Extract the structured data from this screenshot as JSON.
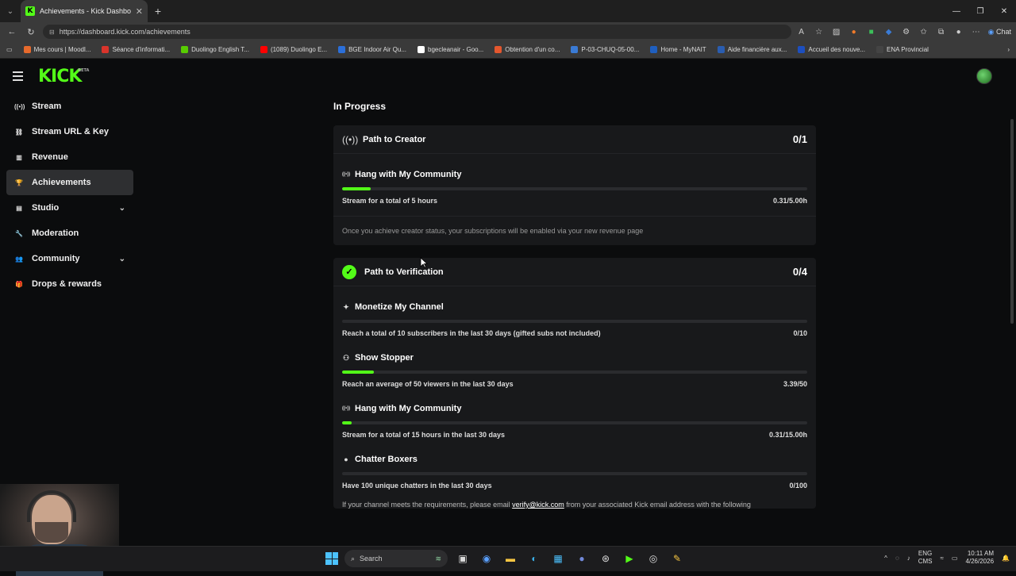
{
  "browser": {
    "tab_title": "Achievements - Kick Dashboard",
    "url": "https://dashboard.kick.com/achievements",
    "chat_label": "Chat",
    "bookmarks": [
      {
        "label": "Mes cours | Moodl...",
        "color": "#e66a2c"
      },
      {
        "label": "Séance d'informati...",
        "color": "#d9342b"
      },
      {
        "label": "Duolingo English T...",
        "color": "#58cc02"
      },
      {
        "label": "(1089) Duolingo E...",
        "color": "#ff0000"
      },
      {
        "label": "BGE Indoor Air Qu...",
        "color": "#2b6fd9"
      },
      {
        "label": "bgecleanair - Goo...",
        "color": "#ffffff"
      },
      {
        "label": "Obtention d'un co...",
        "color": "#e4572e"
      },
      {
        "label": "P-03-CHUQ-05-00...",
        "color": "#3a7bd5"
      },
      {
        "label": "Home - MyNAIT",
        "color": "#1f5fbf"
      },
      {
        "label": "Aide financière aux...",
        "color": "#2a5db0"
      },
      {
        "label": "Accueil des nouve...",
        "color": "#1d4fbf"
      },
      {
        "label": "ENA Provincial",
        "color": "#444444"
      }
    ]
  },
  "header": {
    "logo": "KICK",
    "logo_badge": "BETA"
  },
  "sidebar": {
    "items": [
      {
        "label": "Stream",
        "icon": "broadcast-icon"
      },
      {
        "label": "Stream URL & Key",
        "icon": "link-icon"
      },
      {
        "label": "Revenue",
        "icon": "chart-icon"
      },
      {
        "label": "Achievements",
        "icon": "trophy-icon",
        "active": true
      },
      {
        "label": "Studio",
        "icon": "studio-icon",
        "expandable": true
      },
      {
        "label": "Moderation",
        "icon": "wrench-icon"
      },
      {
        "label": "Community",
        "icon": "people-icon",
        "expandable": true
      },
      {
        "label": "Drops & rewards",
        "icon": "gift-icon"
      }
    ]
  },
  "main": {
    "section_title": "In Progress",
    "creator": {
      "title": "Path to Creator",
      "count": "0/1",
      "achievements": [
        {
          "title": "Hang with My Community",
          "desc": "Stream for a total of 5 hours",
          "value": "0.31/5.00h",
          "progress": 0.062
        }
      ],
      "note": "Once you achieve creator status, your subscriptions will be enabled via your new revenue page"
    },
    "verification": {
      "title": "Path to Verification",
      "count": "0/4",
      "achievements": [
        {
          "title": "Monetize My Channel",
          "desc": "Reach a total of 10 subscribers in the last 30 days (gifted subs not included)",
          "value": "0/10",
          "progress": 0.0
        },
        {
          "title": "Show Stopper",
          "desc": "Reach an average of 50 viewers in the last 30 days",
          "value": "3.39/50",
          "progress": 0.068
        },
        {
          "title": "Hang with My Community",
          "desc": "Stream for a total of 15 hours in the last 30 days",
          "value": "0.31/15.00h",
          "progress": 0.021
        },
        {
          "title": "Chatter Boxers",
          "desc": "Have 100 unique chatters in the last 30 days",
          "value": "0/100",
          "progress": 0.0
        }
      ],
      "footer_pre": "If your channel meets the requirements, please email ",
      "footer_link": "verify@kick.com",
      "footer_post": " from your associated Kick email address with the following"
    }
  },
  "taskbar": {
    "search_placeholder": "Search",
    "lang_top": "ENG",
    "lang_bottom": "CMS",
    "time": "10:11 AM",
    "date": "4/26/2026"
  },
  "colors": {
    "accent": "#53fc18",
    "background": "#0b0c0d",
    "card": "#18191b"
  }
}
